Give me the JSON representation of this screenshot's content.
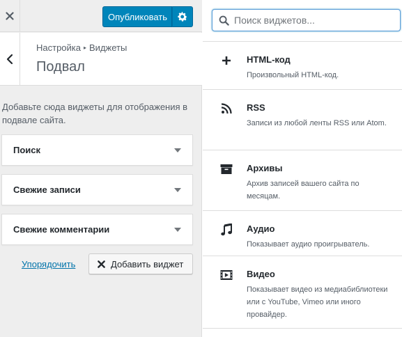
{
  "topbar": {
    "close_icon": "close-icon",
    "publish_label": "Опубликовать",
    "settings_icon": "gear-icon"
  },
  "section": {
    "back_icon": "chevron-left-icon",
    "breadcrumb": {
      "first": "Настройка",
      "second": "Виджеты"
    },
    "title": "Подвал"
  },
  "description": "Добавьте сюда виджеты для отображения в подвале сайта.",
  "area_widgets": [
    {
      "label": "Поиск"
    },
    {
      "label": "Свежие записи"
    },
    {
      "label": "Свежие комментарии"
    }
  ],
  "actions": {
    "reorder_label": "Упорядочить",
    "add_label": "Добавить виджет"
  },
  "search": {
    "placeholder": "Поиск виджетов...",
    "value": ""
  },
  "available_widgets": [
    {
      "icon": "plus-icon",
      "title": "HTML-код",
      "desc": "Произвольный HTML-код."
    },
    {
      "icon": "rss-icon",
      "title": "RSS",
      "desc": "Записи из любой ленты RSS или Atom."
    },
    {
      "icon": "archive-icon",
      "title": "Архивы",
      "desc": "Архив записей вашего сайта по месяцам."
    },
    {
      "icon": "music-note-icon",
      "title": "Аудио",
      "desc": "Показывает аудио проигрыватель."
    },
    {
      "icon": "video-icon",
      "title": "Видео",
      "desc": "Показывает видео из медиабиблиотеки или с YouTube, Vimeo или иного провайдер."
    }
  ],
  "colors": {
    "primary": "#0085ba",
    "link": "#0073aa",
    "panel_bg": "#eeeeee"
  }
}
